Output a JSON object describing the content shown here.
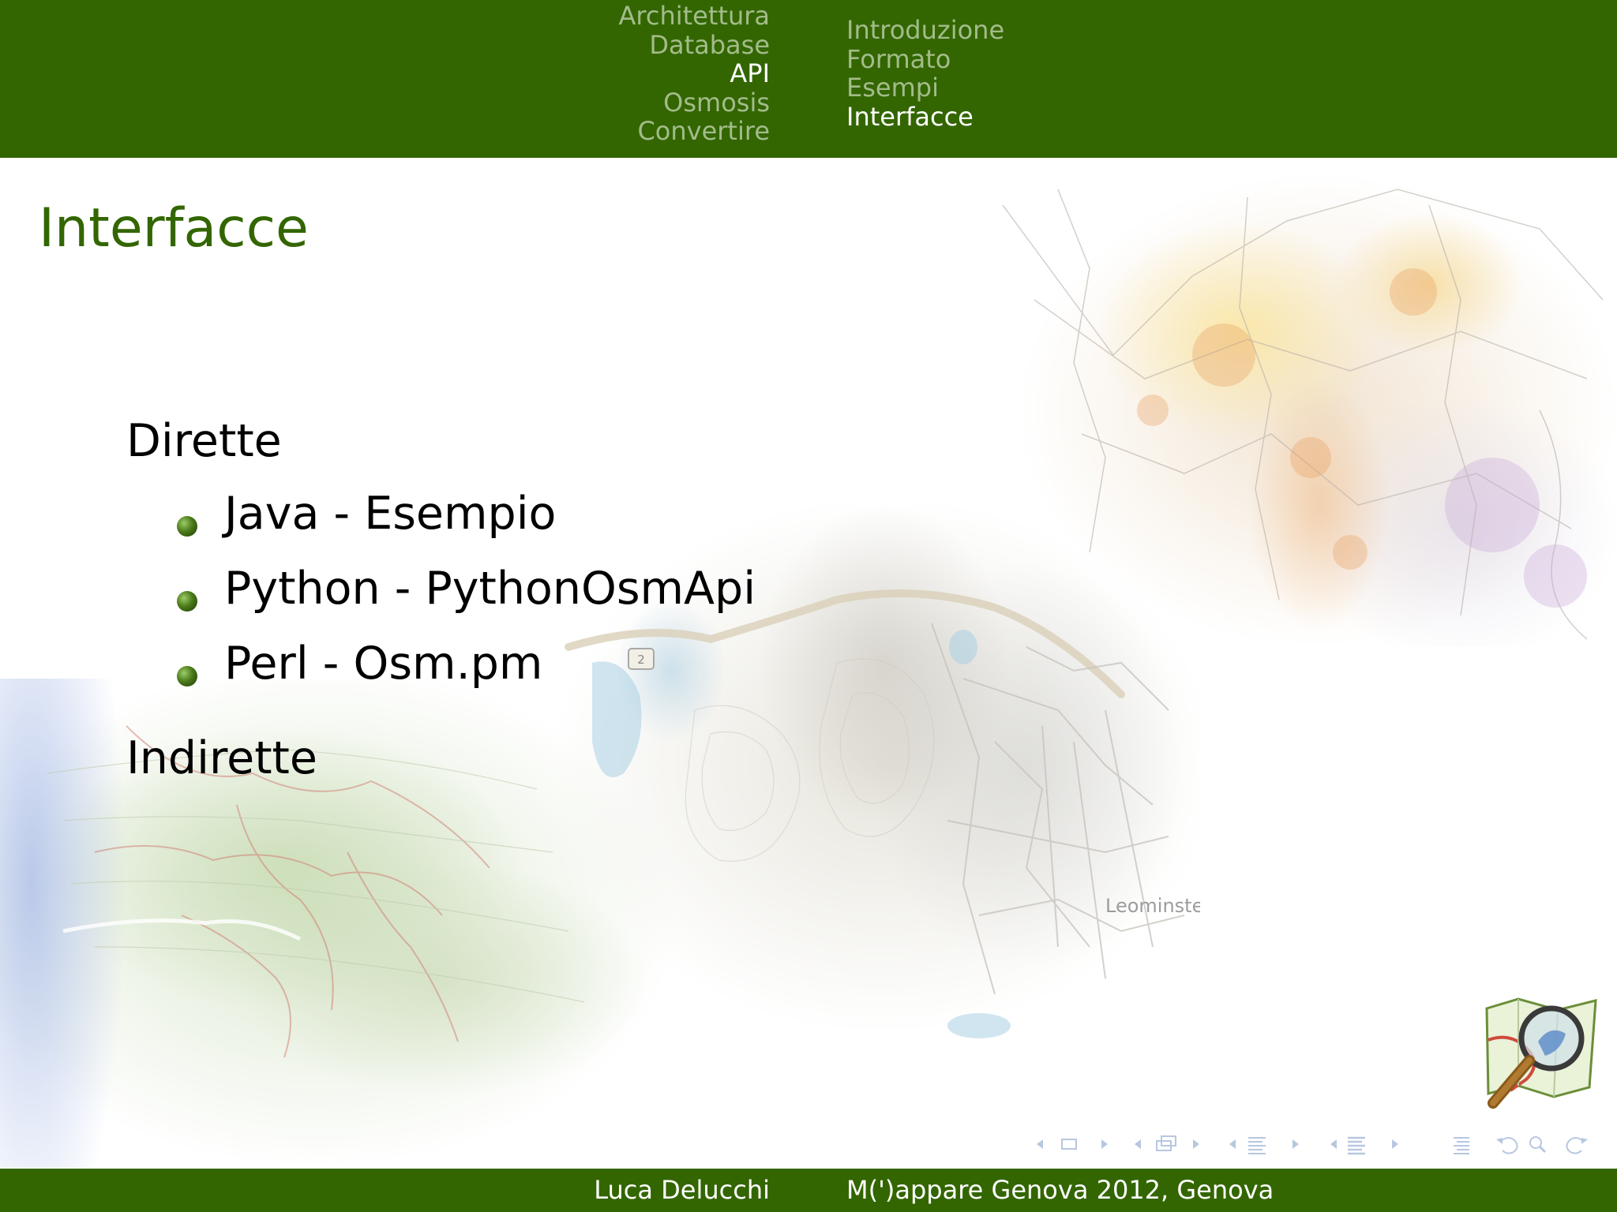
{
  "header": {
    "sections": [
      {
        "label": "Architettura",
        "active": false
      },
      {
        "label": "Database",
        "active": false
      },
      {
        "label": "API",
        "active": true
      },
      {
        "label": "Osmosis",
        "active": false
      },
      {
        "label": "Convertire",
        "active": false
      }
    ],
    "subsections": [
      {
        "label": "Introduzione",
        "active": false
      },
      {
        "label": "Formato",
        "active": false
      },
      {
        "label": "Esempi",
        "active": false
      },
      {
        "label": "Interfacce",
        "active": true
      }
    ]
  },
  "slide": {
    "title": "Interfacce",
    "direct_heading": "Dirette",
    "direct_items": [
      "Java - Esempio",
      "Python - PythonOsmApi",
      "Perl - Osm.pm"
    ],
    "indirect_heading": "Indirette"
  },
  "map_labels": {
    "route": "2",
    "city": "Leominster"
  },
  "footer": {
    "author": "Luca Delucchi",
    "event": "M(')appare Genova 2012, Genova"
  },
  "colors": {
    "header_bg": "#336600",
    "title": "#336600",
    "nav_inactive": "#a3bc8a",
    "nav_active": "#ffffff",
    "nav_symbols": "#b8c7e0"
  },
  "icons": {
    "bullet": "green-ball-bullet-icon",
    "logo": "openstreetmap-logo-icon",
    "navigation": [
      "frame-nav-icon",
      "subsection-nav-icon",
      "section-nav-icon",
      "doc-nav-icon",
      "toc-icon",
      "undo-icon",
      "search-icon",
      "redo-icon"
    ]
  }
}
